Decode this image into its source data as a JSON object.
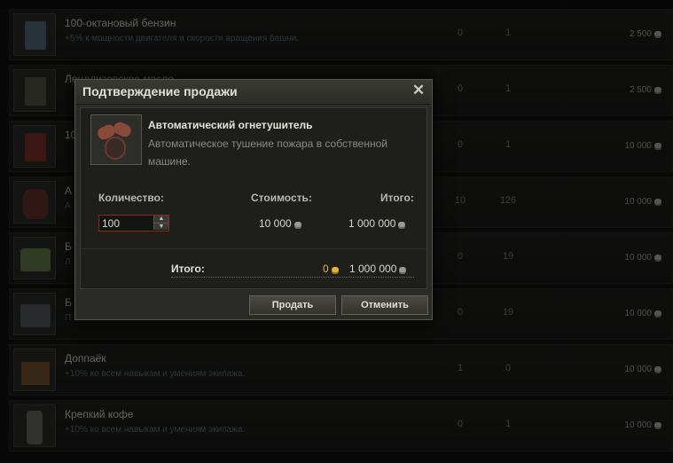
{
  "rows": [
    {
      "name": "100-октановый бензин",
      "desc": "+5% к мощности двигателя и скорости вращения башни.",
      "c1": "0",
      "c2": "1",
      "price": "2 500"
    },
    {
      "name": "Лендлизовское масло",
      "desc": "",
      "c1": "0",
      "c2": "1",
      "price": "2 500"
    },
    {
      "name": "10",
      "desc": "",
      "c1": "0",
      "c2": "1",
      "price": "10 000"
    },
    {
      "name": "А",
      "desc": "А",
      "c1": "10",
      "c2": "126",
      "price": "10 000"
    },
    {
      "name": "Б",
      "desc": "Л",
      "c1": "0",
      "c2": "19",
      "price": "10 000"
    },
    {
      "name": "Б",
      "desc": "П",
      "c1": "0",
      "c2": "19",
      "price": "10 000"
    },
    {
      "name": "Доппаёк",
      "desc": "+10% ко всем навыкам и умениям экипажа.",
      "c1": "1",
      "c2": "0",
      "price": "10 000"
    },
    {
      "name": "Крепкий кофе",
      "desc": "+10% ко всем навыкам и умениям экипажа.",
      "c1": "0",
      "c2": "1",
      "price": "10 000"
    }
  ],
  "dialog": {
    "title": "Подтверждение продажи",
    "item_name": "Автоматический огнетушитель",
    "item_desc": "Автоматическое тушение пожара в собственной машине.",
    "qty_label": "Количество:",
    "cost_label": "Стоимость:",
    "total_col_label": "Итого:",
    "qty_value": "100",
    "unit_cost": "10 000",
    "line_total": "1 000 000",
    "total_label": "Итого:",
    "total_gold": "0",
    "total_credits": "1 000 000",
    "sell_label": "Продать",
    "cancel_label": "Отменить",
    "close_glyph": "✕"
  },
  "icons": {
    "credit": "credit-coin-icon",
    "gold": "gold-coin-icon"
  },
  "colors": {
    "accent_gold": "#e2b23a",
    "qty_border": "#8a2a1f",
    "row_desc": "#4a6470"
  }
}
